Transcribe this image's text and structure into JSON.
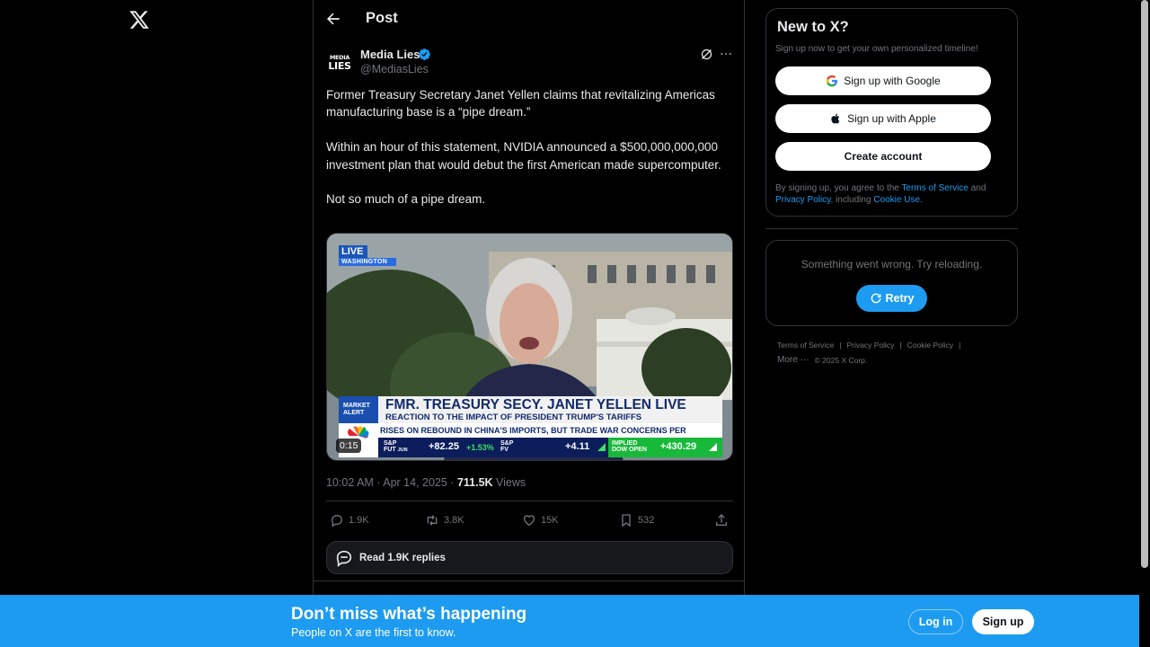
{
  "nav": {
    "logo_icon": "x-logo-icon"
  },
  "header": {
    "title": "Post",
    "back_icon": "arrow-left-icon"
  },
  "post": {
    "author_name": "Media Lies",
    "author_handle": "@MediasLies",
    "avatar_text_top": "MEDIA",
    "avatar_text_bottom": "LIES",
    "text": "Former Treasury Secretary Janet Yellen claims that revitalizing Americas manufacturing base is a “pipe dream.”\n\nWithin an hour of this statement, NVIDIA announced a $500,000,000,000 investment  plan that would debut the first American made supercomputer.\n\nNot so much of a pipe dream.",
    "timestamp": "10:02 AM · Apr 14, 2025 · ",
    "views_count": "711.5K",
    "views_label": " Views",
    "media": {
      "live_label": "LIVE",
      "live_location": "WASHINGTON",
      "alert_label_1": "MARKET",
      "alert_label_2": "ALERT",
      "headline": "FMR. TREASURY SECY. JANET YELLEN LIVE",
      "subhead": "REACTION TO THE IMPACT OF PRESIDENT TRUMP'S TARIFFS",
      "ticker": "RISES ON REBOUND IN CHINA'S IMPORTS, BUT TRADE WAR CONCERNS PER",
      "stock1_label_1": "S&P",
      "stock1_label_2": "FUT",
      "stock1_label_3": "JUN",
      "stock1_change": "+82.25",
      "stock1_pct": "+1.53%",
      "stock2_label_1": "S&P",
      "stock2_label_2": "FV",
      "stock2_change": "+4.11",
      "stock3_label_1": "IMPLIED",
      "stock3_label_2": "DOW OPEN",
      "stock3_change": "+430.29",
      "network_logo": "cnbc",
      "video_time": "0:15"
    },
    "actions": {
      "replies": "1.9K",
      "reposts": "3.8K",
      "likes": "15K",
      "bookmarks": "532"
    },
    "read_replies": "Read 1.9K replies"
  },
  "signup": {
    "title": "New to X?",
    "subtitle": "Sign up now to get your own personalized timeline!",
    "google": "Sign up with Google",
    "apple": "Sign up with Apple",
    "create": "Create account",
    "terms_prefix": "By signing up, you agree to the ",
    "terms_link": "Terms of Service",
    "terms_and": " and ",
    "privacy_link": "Privacy Policy",
    "terms_including": ", including ",
    "cookie_link": "Cookie Use",
    "terms_suffix": "."
  },
  "error_card": {
    "message": "Something went wrong. Try reloading.",
    "retry": "Retry"
  },
  "footer": {
    "terms": "Terms of Service",
    "privacy": "Privacy Policy",
    "cookie": "Cookie Policy",
    "more": "More ···",
    "copyright": "© 2025 X Corp."
  },
  "banner": {
    "title": "Don’t miss what’s happening",
    "subtitle": "People on X are the first to know.",
    "login": "Log in",
    "signup": "Sign up"
  },
  "colors": {
    "accent": "#1d9bf0",
    "background": "#000000",
    "border": "#2f3336",
    "muted": "#71767b"
  }
}
